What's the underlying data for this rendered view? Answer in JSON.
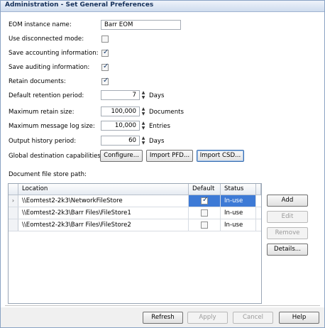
{
  "window": {
    "title": "Administration - Set General Preferences"
  },
  "form": {
    "eom_instance_name": {
      "label": "EOM instance name:",
      "value": "Barr EOM"
    },
    "use_disconnected_mode": {
      "label": "Use disconnected mode:",
      "checked": false
    },
    "save_accounting": {
      "label": "Save accounting information:",
      "checked": true,
      "mark": "✓"
    },
    "save_auditing": {
      "label": "Save auditing information:",
      "checked": true,
      "mark": "✓"
    },
    "retain_documents": {
      "label": "Retain documents:",
      "checked": true,
      "mark": "✓"
    },
    "default_retention": {
      "label": "Default retention period:",
      "value": "7",
      "unit": "Days"
    },
    "max_retain_size": {
      "label": "Maximum retain size:",
      "value": "100,000",
      "unit": "Documents"
    },
    "max_log_size": {
      "label": "Maximum message log size:",
      "value": "10,000",
      "unit": "Entries"
    },
    "output_history": {
      "label": "Output history period:",
      "value": "60",
      "unit": "Days"
    },
    "global_destination": {
      "label": "Global destination capabilities:",
      "configure_label": "Configure...",
      "import_pfd_label": "Import PFD...",
      "import_csd_label": "Import CSD..."
    },
    "file_store_label": "Document file store path:"
  },
  "grid": {
    "columns": {
      "location": "Location",
      "default": "Default",
      "status": "Status"
    },
    "row_marker": "›",
    "rows": [
      {
        "location": "\\\\Eomtest2-2k3\\NetworkFileStore",
        "default": true,
        "mark": "✓",
        "status": "In-use"
      },
      {
        "location": "\\\\Eomtest2-2k3\\Barr Files\\FileStore1",
        "default": false,
        "mark": "",
        "status": "In-use"
      },
      {
        "location": "\\\\Eomtest2-2k3\\Barr Files\\FileStore2",
        "default": false,
        "mark": "",
        "status": "In-use"
      }
    ]
  },
  "side_buttons": {
    "add": "Add",
    "edit": "Edit",
    "remove": "Remove",
    "details": "Details..."
  },
  "footer": {
    "refresh": "Refresh",
    "apply": "Apply",
    "cancel": "Cancel",
    "help": "Help"
  },
  "colors": {
    "selection": "#3d7ad6",
    "title_text": "#15305a",
    "accent_border": "#3a6fb0"
  },
  "icons": {
    "spin_up": "▲",
    "spin_down": "▼"
  }
}
